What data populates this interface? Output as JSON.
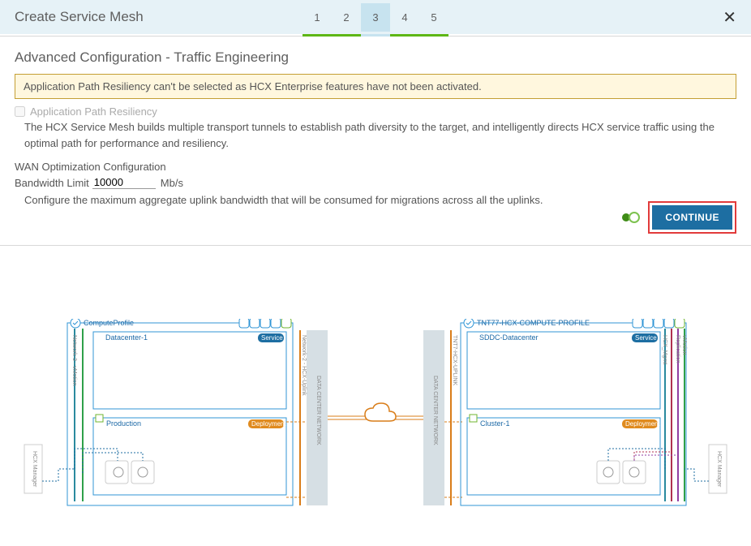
{
  "header": {
    "title": "Create Service Mesh",
    "steps": [
      "1",
      "2",
      "3",
      "4",
      "5"
    ],
    "activeStep": "3",
    "close": "✕"
  },
  "section": {
    "heading": "Advanced Configuration - Traffic Engineering",
    "warning": "Application Path Resiliency can't be selected as HCX Enterprise features have not been activated.",
    "aprLabel": "Application Path Resiliency",
    "aprDesc": "The HCX Service Mesh builds multiple transport tunnels to establish path diversity to the target, and intelligently directs HCX service traffic using the optimal path for performance and resiliency.",
    "wanTitle": "WAN Optimization Configuration",
    "bwLabel": "Bandwidth Limit",
    "bwValue": "10000",
    "bwUnit": "Mb/s",
    "bwHelp": "Configure the maximum aggregate uplink bandwidth that will be consumed for migrations across all the uplinks.",
    "continue": "CONTINUE"
  },
  "diagram": {
    "left": {
      "profile": "ComputeProfile",
      "datacenter": "Datacenter-1",
      "serviceTag": "Service",
      "cluster": "Production",
      "deployTag": "Deployment",
      "netLabels": [
        "Network-3 - vMotion",
        "Network-2 - HCX-Uplink"
      ],
      "vertBox": "DATA CENTER NETWORK",
      "manager": "HCX Manager"
    },
    "right": {
      "profile": "TNT77-HCX-COMPUTE-PROFILE",
      "datacenter": "SDDC-Datacenter",
      "serviceTag": "Service",
      "cluster": "Cluster-1",
      "deployTag": "Deployment",
      "netLabels": [
        "TNT7-HCX-UPLINK",
        "HCX_Mgmt",
        "Replication",
        "vMotion"
      ],
      "vertBox": "DATA CENTER NETWORK",
      "manager": "HCX Manager"
    }
  }
}
